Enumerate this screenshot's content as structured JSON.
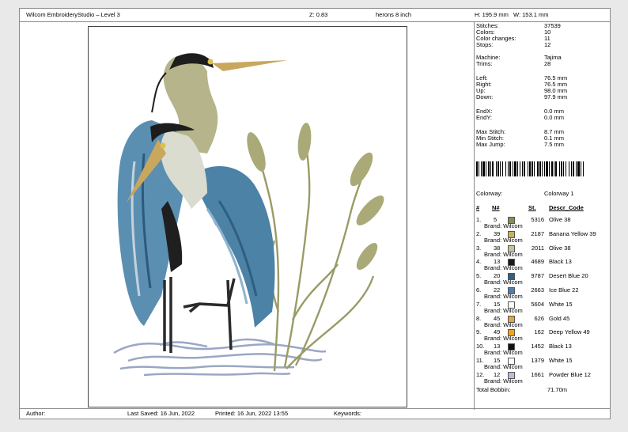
{
  "header": {
    "app_title": "Wilcom EmbroideryStudio – Level 3",
    "zoom": "Z: 0.83",
    "design_name": "herons 8 inch",
    "height": "H: 195.9 mm",
    "width": "W: 153.1 mm"
  },
  "footer": {
    "author": "Author:",
    "last_saved": "Last Saved:  16 Jun, 2022",
    "printed": "Printed:  16 Jun, 2022 13:55",
    "keywords": "Keywords:"
  },
  "stats": [
    {
      "label": "Stitches:",
      "value": "37539"
    },
    {
      "label": "Colors:",
      "value": "10"
    },
    {
      "label": "Color changes:",
      "value": "11"
    },
    {
      "label": "Stops:",
      "value": "12"
    },
    {
      "label": "Machine:",
      "value": "Tajima"
    },
    {
      "label": "Trims:",
      "value": "28"
    },
    {
      "label": "Left:",
      "value": "76.5 mm"
    },
    {
      "label": "Right:",
      "value": "76.5 mm"
    },
    {
      "label": "Up:",
      "value": "98.0 mm"
    },
    {
      "label": "Down:",
      "value": "97.9 mm"
    },
    {
      "label": "EndX:",
      "value": "0.0 mm"
    },
    {
      "label": "EndY:",
      "value": "0.0 mm"
    },
    {
      "label": "Max Stitch:",
      "value": "8.7 mm"
    },
    {
      "label": "Min Stitch:",
      "value": "0.1 mm"
    },
    {
      "label": "Max Jump:",
      "value": "7.5 mm"
    }
  ],
  "colorway": {
    "label": "Colorway:",
    "value": "Colorway 1"
  },
  "table_headers": {
    "num": "#",
    "n": "N#",
    "st": "St.",
    "descr": "Descr_Code"
  },
  "colors": [
    {
      "idx": "1.",
      "n": "5",
      "st": "5316",
      "descr": "Olive 38",
      "brand": "Brand: Wilcom",
      "hex": "#8c8a55"
    },
    {
      "idx": "2.",
      "n": "39",
      "st": "2187",
      "descr": "Banana Yellow 39",
      "brand": "Brand: Wilcom",
      "hex": "#c9b25a"
    },
    {
      "idx": "3.",
      "n": "38",
      "st": "2011",
      "descr": "Olive 38",
      "brand": "Brand: Wilcom",
      "hex": "#c8c29a"
    },
    {
      "idx": "4.",
      "n": "13",
      "st": "4689",
      "descr": "Black 13",
      "brand": "Brand: Wilcom",
      "hex": "#1a1a1a"
    },
    {
      "idx": "5.",
      "n": "20",
      "st": "9787",
      "descr": "Desert Blue 20",
      "brand": "Brand: Wilcom",
      "hex": "#2f5f86"
    },
    {
      "idx": "6.",
      "n": "22",
      "st": "2663",
      "descr": "Ice Blue 22",
      "brand": "Brand: Wilcom",
      "hex": "#4f7fa8"
    },
    {
      "idx": "7.",
      "n": "15",
      "st": "5604",
      "descr": "White 15",
      "brand": "Brand: Wilcom",
      "hex": "#ffffff"
    },
    {
      "idx": "8.",
      "n": "45",
      "st": "626",
      "descr": "Gold 45",
      "brand": "Brand: Wilcom",
      "hex": "#e2a347"
    },
    {
      "idx": "9.",
      "n": "49",
      "st": "162",
      "descr": "Deep Yellow 49",
      "brand": "Brand: Wilcom",
      "hex": "#f1a41a"
    },
    {
      "idx": "10.",
      "n": "13",
      "st": "1452",
      "descr": "Black 13",
      "brand": "Brand: Wilcom",
      "hex": "#111111"
    },
    {
      "idx": "11.",
      "n": "15",
      "st": "1379",
      "descr": "White 15",
      "brand": "Brand: Wilcom",
      "hex": "#ffffff"
    },
    {
      "idx": "12.",
      "n": "12",
      "st": "1661",
      "descr": "Powder Blue 12",
      "brand": "Brand: Wilcom",
      "hex": "#b7bfd8"
    }
  ],
  "total": {
    "label": "Total Bobbin:",
    "value": "71.70m"
  }
}
